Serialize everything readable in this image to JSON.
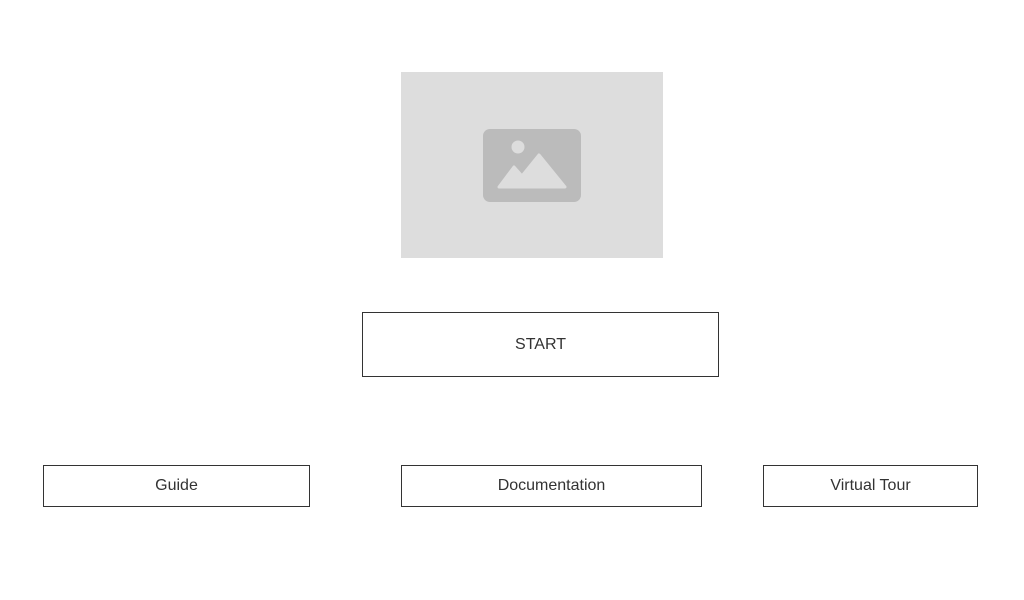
{
  "hero": {
    "icon": "image-placeholder-icon",
    "background_color": "#dddddd",
    "icon_color": "#bbbbbb"
  },
  "start_button": {
    "label": "START"
  },
  "links": {
    "guide": "Guide",
    "documentation": "Documentation",
    "virtual_tour": "Virtual Tour"
  },
  "colors": {
    "border": "#333333",
    "text": "#333333",
    "background": "#ffffff"
  }
}
